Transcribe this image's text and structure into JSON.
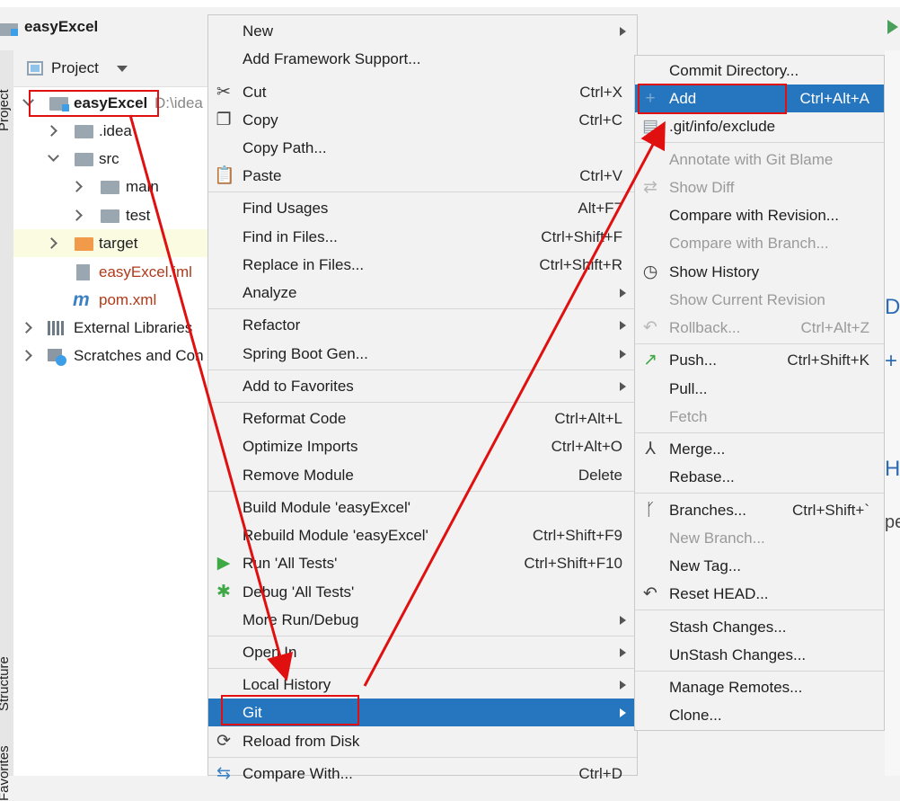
{
  "title": "easyExcel",
  "tool_strip": {
    "project": "Project",
    "structure": "Structure",
    "favorites": "Favorites"
  },
  "project_panel": {
    "header": "Project",
    "tree": [
      {
        "label": "easyExcel",
        "suffix": "D:\\idea",
        "icon": "module-folder-icon",
        "expanded": true
      },
      {
        "label": ".idea",
        "icon": "folder-icon",
        "expanded": false
      },
      {
        "label": "src",
        "icon": "folder-icon",
        "expanded": true
      },
      {
        "label": "main",
        "icon": "folder-icon",
        "expanded": false
      },
      {
        "label": "test",
        "icon": "folder-icon",
        "expanded": false
      },
      {
        "label": "target",
        "icon": "orange-folder-icon",
        "expanded": false
      },
      {
        "label": "easyExcel.iml",
        "icon": "iml-file-icon"
      },
      {
        "label": "pom.xml",
        "icon": "maven-icon"
      },
      {
        "label": "External Libraries",
        "icon": "libraries-icon",
        "expanded": false
      },
      {
        "label": "Scratches and Con",
        "icon": "scratches-icon",
        "expanded": false
      }
    ]
  },
  "context_menu": {
    "items": [
      {
        "label": "New",
        "submenu": true
      },
      {
        "label": "Add Framework Support..."
      },
      {
        "label": "Cut",
        "shortcut": "Ctrl+X",
        "icon": "scissors-icon"
      },
      {
        "label": "Copy",
        "shortcut": "Ctrl+C",
        "icon": "copy-icon"
      },
      {
        "label": "Copy Path..."
      },
      {
        "label": "Paste",
        "shortcut": "Ctrl+V",
        "icon": "clipboard-icon"
      },
      {
        "label": "Find Usages",
        "shortcut": "Alt+F7"
      },
      {
        "label": "Find in Files...",
        "shortcut": "Ctrl+Shift+F"
      },
      {
        "label": "Replace in Files...",
        "shortcut": "Ctrl+Shift+R"
      },
      {
        "label": "Analyze",
        "submenu": true
      },
      {
        "label": "Refactor",
        "submenu": true
      },
      {
        "label": "Spring Boot Gen...",
        "submenu": true
      },
      {
        "label": "Add to Favorites",
        "submenu": true
      },
      {
        "label": "Reformat Code",
        "shortcut": "Ctrl+Alt+L"
      },
      {
        "label": "Optimize Imports",
        "shortcut": "Ctrl+Alt+O"
      },
      {
        "label": "Remove Module",
        "shortcut": "Delete"
      },
      {
        "label": "Build Module 'easyExcel'"
      },
      {
        "label": "Rebuild Module 'easyExcel'",
        "shortcut": "Ctrl+Shift+F9"
      },
      {
        "label": "Run 'All Tests'",
        "shortcut": "Ctrl+Shift+F10",
        "icon": "run-icon"
      },
      {
        "label": "Debug 'All Tests'",
        "icon": "debug-icon"
      },
      {
        "label": "More Run/Debug",
        "submenu": true
      },
      {
        "label": "Open In",
        "submenu": true
      },
      {
        "label": "Local History",
        "submenu": true
      },
      {
        "label": "Git",
        "submenu": true,
        "selected": true
      },
      {
        "label": "Reload from Disk",
        "icon": "reload-icon"
      },
      {
        "label": "Compare With...",
        "shortcut": "Ctrl+D",
        "icon": "compare-icon"
      }
    ]
  },
  "git_submenu": {
    "items": [
      {
        "label": "Commit Directory..."
      },
      {
        "label": "Add",
        "shortcut": "Ctrl+Alt+A",
        "icon": "plus-icon",
        "selected": true
      },
      {
        "label": ".git/info/exclude",
        "icon": "exclude-file-icon"
      },
      {
        "label": "Annotate with Git Blame",
        "disabled": true
      },
      {
        "label": "Show Diff",
        "disabled": true,
        "icon": "diff-icon"
      },
      {
        "label": "Compare with Revision..."
      },
      {
        "label": "Compare with Branch...",
        "disabled": true
      },
      {
        "label": "Show History",
        "icon": "history-icon"
      },
      {
        "label": "Show Current Revision",
        "disabled": true
      },
      {
        "label": "Rollback...",
        "shortcut": "Ctrl+Alt+Z",
        "disabled": true,
        "icon": "rollback-icon"
      },
      {
        "label": "Push...",
        "shortcut": "Ctrl+Shift+K",
        "icon": "push-icon"
      },
      {
        "label": "Pull..."
      },
      {
        "label": "Fetch",
        "disabled": true
      },
      {
        "label": "Merge...",
        "icon": "merge-icon"
      },
      {
        "label": "Rebase..."
      },
      {
        "label": "Branches...",
        "shortcut": "Ctrl+Shift+`",
        "icon": "branch-icon"
      },
      {
        "label": "New Branch...",
        "disabled": true
      },
      {
        "label": "New Tag..."
      },
      {
        "label": "Reset HEAD...",
        "icon": "reset-icon"
      },
      {
        "label": "Stash Changes..."
      },
      {
        "label": "UnStash Changes..."
      },
      {
        "label": "Manage Remotes..."
      },
      {
        "label": "Clone..."
      }
    ]
  },
  "editor_fragments": [
    "Do",
    "+",
    "He",
    "pe"
  ],
  "colors": {
    "selection": "#2675bf",
    "annotation": "#e01010",
    "disabled": "#9a9a9a"
  }
}
